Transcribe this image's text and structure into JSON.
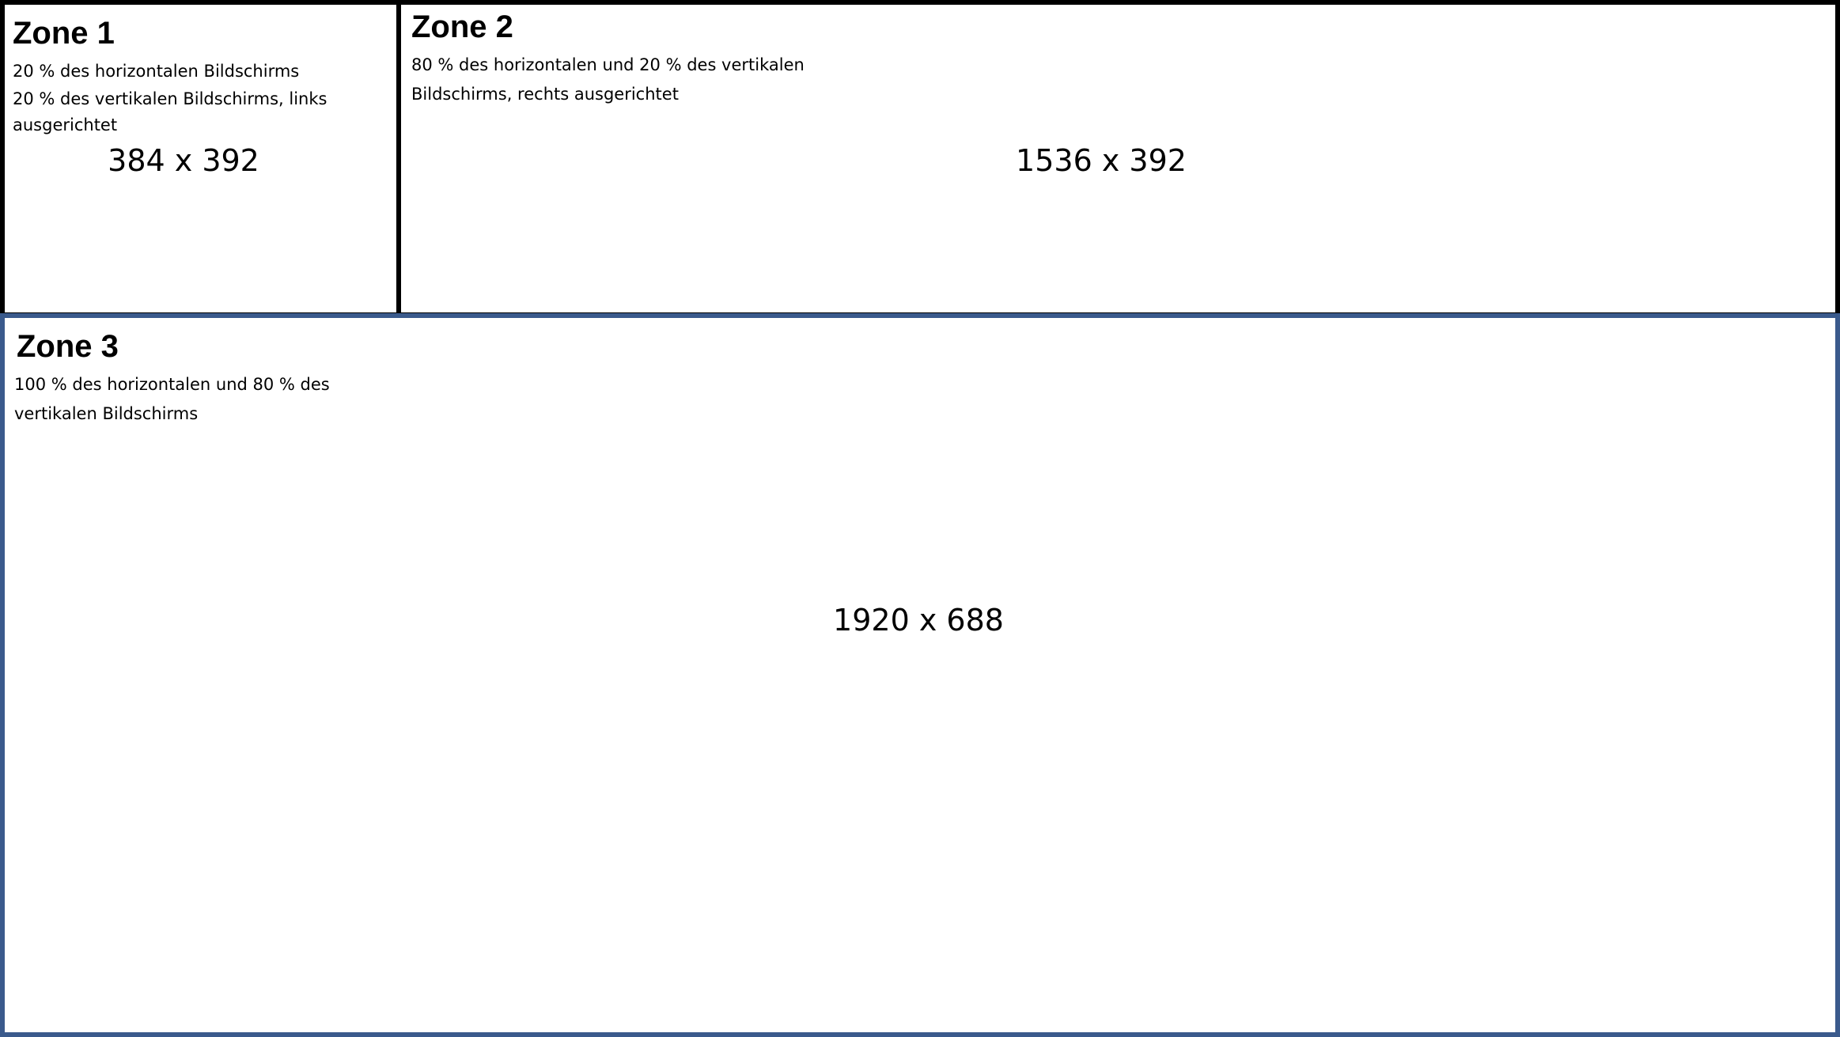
{
  "zones": [
    {
      "title": "Zone 1",
      "description_line1": "20 % des horizontalen Bildschirms",
      "description_line2": "20 % des vertikalen Bildschirms, links ausgerichtet",
      "size": "384 x 392",
      "border_color": "#000000"
    },
    {
      "title": "Zone 2",
      "description": "80 % des horizontalen und 20 % des vertikalen Bildschirms, rechts ausgerichtet",
      "size": "1536 x 392",
      "border_color": "#000000"
    },
    {
      "title": "Zone 3",
      "description": "100 % des horizontalen und 80 % des vertikalen Bildschirms",
      "size": "1920 x 688",
      "border_color": "#3a5a8c"
    }
  ]
}
